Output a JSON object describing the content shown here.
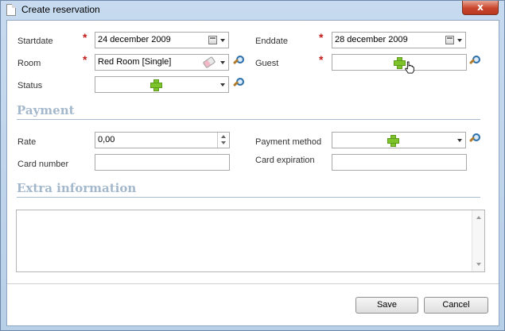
{
  "window": {
    "title": "Create reservation",
    "close_label": "x"
  },
  "form": {
    "startdate": {
      "label": "Startdate",
      "value": "24 december 2009",
      "required": true
    },
    "enddate": {
      "label": "Enddate",
      "value": "28 december 2009",
      "required": true
    },
    "room": {
      "label": "Room",
      "value": "Red Room [Single]",
      "required": true
    },
    "guest": {
      "label": "Guest",
      "value": "",
      "required": true
    },
    "status": {
      "label": "Status",
      "value": ""
    },
    "required_marker": "*"
  },
  "payment": {
    "heading": "Payment",
    "rate": {
      "label": "Rate",
      "value": "0,00"
    },
    "payment_method": {
      "label": "Payment method",
      "value": ""
    },
    "card_number": {
      "label": "Card number",
      "value": ""
    },
    "card_expiration": {
      "label": "Card expiration",
      "value": ""
    }
  },
  "extra": {
    "heading": "Extra information",
    "value": ""
  },
  "footer": {
    "save_label": "Save",
    "cancel_label": "Cancel"
  },
  "colors": {
    "required": "#c21c1c",
    "section_heading": "#a4b8cc",
    "add_icon": "#7dc42a",
    "title_bar": "#c7daef",
    "close_button": "#c8452c"
  },
  "icons": [
    "document-icon",
    "close-icon",
    "calendar-icon",
    "dropdown-arrow-icon",
    "add-icon",
    "search-icon",
    "eraser-icon",
    "spinner-icon",
    "cursor-hand-icon"
  ]
}
